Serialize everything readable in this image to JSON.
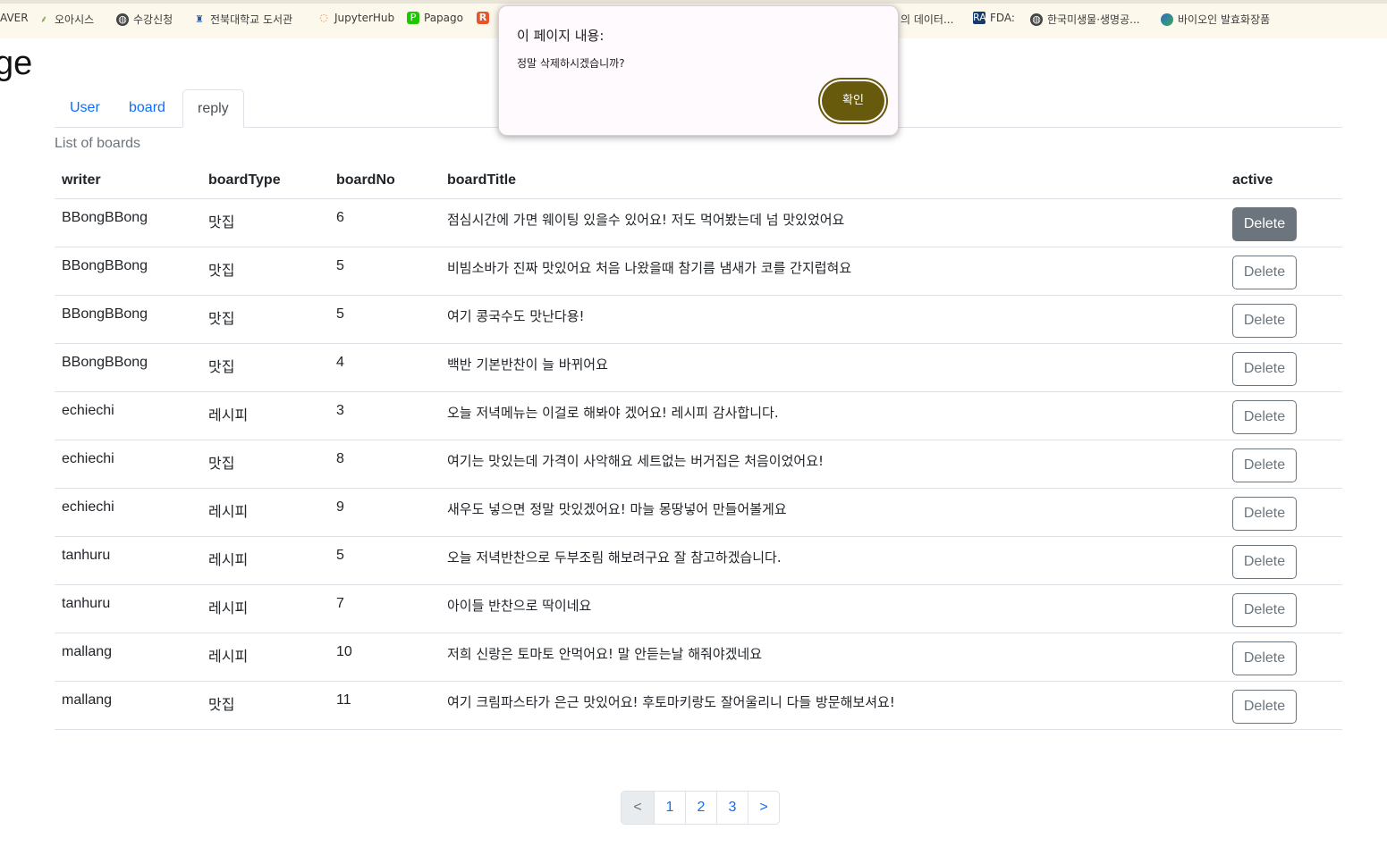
{
  "bookmarks": [
    {
      "label": "AVER",
      "icon": "none"
    },
    {
      "label": "오아시스",
      "icon": "plant-icon"
    },
    {
      "label": "수강신청",
      "icon": "globe-icon"
    },
    {
      "label": "전북대학교 도서관",
      "icon": "library-icon"
    },
    {
      "label": "JupyterHub",
      "icon": "jupyter-icon"
    },
    {
      "label": "Papago",
      "icon": "papago-icon"
    },
    {
      "label": "R",
      "icon": "r-icon"
    },
    {
      "label": "의 데이터...",
      "icon": "none"
    },
    {
      "label": "FDA:",
      "icon": "raps-icon"
    },
    {
      "label": "한국미생물·생명공...",
      "icon": "globe-icon"
    },
    {
      "label": "바이오인 발효화장품",
      "icon": "bio-icon"
    }
  ],
  "page": {
    "heading": "ge"
  },
  "tabs": [
    {
      "label": "User",
      "active": false
    },
    {
      "label": "board",
      "active": false
    },
    {
      "label": "reply",
      "active": true
    }
  ],
  "table": {
    "caption": "List of boards",
    "headers": [
      "writer",
      "boardType",
      "boardNo",
      "boardTitle",
      "active"
    ],
    "delete_label": "Delete",
    "rows": [
      {
        "writer": "BBongBBong",
        "boardType": "맛집",
        "boardNo": "6",
        "boardTitle": "점심시간에 가면 웨이팅 있을수 있어요! 저도 먹어봤는데 넘 맛있었어요"
      },
      {
        "writer": "BBongBBong",
        "boardType": "맛집",
        "boardNo": "5",
        "boardTitle": "비빔소바가 진짜 맛있어요 처음 나왔을때 참기름 냄새가 코를 간지럽혀요"
      },
      {
        "writer": "BBongBBong",
        "boardType": "맛집",
        "boardNo": "5",
        "boardTitle": "여기 콩국수도 맛난다용!"
      },
      {
        "writer": "BBongBBong",
        "boardType": "맛집",
        "boardNo": "4",
        "boardTitle": "백반 기본반찬이 늘 바뀌어요"
      },
      {
        "writer": "echiechi",
        "boardType": "레시피",
        "boardNo": "3",
        "boardTitle": "오늘 저녁메뉴는 이걸로 해봐야 겠어요! 레시피 감사합니다."
      },
      {
        "writer": "echiechi",
        "boardType": "맛집",
        "boardNo": "8",
        "boardTitle": "여기는 맛있는데 가격이 사악해요 세트없는 버거집은 처음이었어요!"
      },
      {
        "writer": "echiechi",
        "boardType": "레시피",
        "boardNo": "9",
        "boardTitle": "새우도 넣으면 정말 맛있겠어요! 마늘 몽땅넣어 만들어볼게요"
      },
      {
        "writer": "tanhuru",
        "boardType": "레시피",
        "boardNo": "5",
        "boardTitle": "오늘 저녁반찬으로 두부조림 해보려구요 잘 참고하겠습니다."
      },
      {
        "writer": "tanhuru",
        "boardType": "레시피",
        "boardNo": "7",
        "boardTitle": "아이들 반찬으로 딱이네요"
      },
      {
        "writer": "mallang",
        "boardType": "레시피",
        "boardNo": "10",
        "boardTitle": "저희 신랑은 토마토 안먹어요! 말 안듣는날 해줘야겠네요"
      },
      {
        "writer": "mallang",
        "boardType": "맛집",
        "boardNo": "11",
        "boardTitle": "여기 크림파스타가 은근 맛있어요! 후토마키랑도 잘어울리니 다들 방문해보셔요!"
      }
    ]
  },
  "pagination": {
    "prev": "<",
    "pages": [
      "1",
      "2",
      "3"
    ],
    "next": ">"
  },
  "dialog": {
    "title": "이 페이지 내용:",
    "message": "정말 삭제하시겠습니까?",
    "ok_label": "확인"
  }
}
